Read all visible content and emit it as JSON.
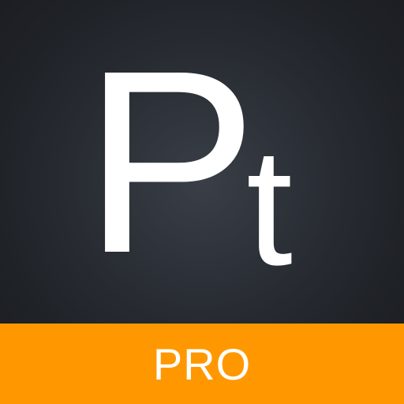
{
  "app_icon": {
    "letter_primary": "P",
    "letter_secondary": "t",
    "badge_label": "PRO"
  },
  "colors": {
    "background_center": "#3a3f47",
    "background_edge": "#1a1c20",
    "lettering": "#ffffff",
    "badge_band": "#ff9800"
  }
}
